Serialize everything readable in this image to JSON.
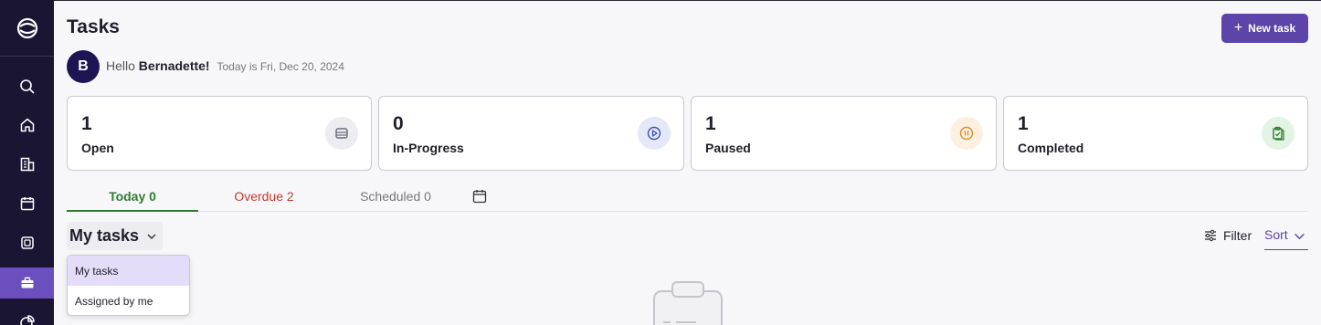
{
  "sidebar": {
    "logo": "app-logo",
    "items": [
      {
        "icon": "search-icon"
      },
      {
        "icon": "home-icon"
      },
      {
        "icon": "building-icon"
      },
      {
        "icon": "calendar-icon"
      },
      {
        "icon": "chip-icon"
      },
      {
        "icon": "briefcase-icon",
        "active": true
      },
      {
        "icon": "chart-icon"
      }
    ]
  },
  "header": {
    "title": "Tasks",
    "new_task_label": "New task",
    "new_task_icon": "+"
  },
  "user": {
    "avatar_initial": "B",
    "hello": "Hello",
    "name": "Bernadette!",
    "date_text": "Today is Fri, Dec 20, 2024"
  },
  "stats": [
    {
      "count": "1",
      "label": "Open",
      "icon": "inbox-icon",
      "color": "#6b6b78",
      "bg": "#ececf1"
    },
    {
      "count": "0",
      "label": "In-Progress",
      "icon": "play-icon",
      "color": "#3f51b5",
      "bg": "#e4e8f8"
    },
    {
      "count": "1",
      "label": "Paused",
      "icon": "pause-icon",
      "color": "#e08a2b",
      "bg": "#fdf0e1"
    },
    {
      "count": "1",
      "label": "Completed",
      "icon": "clipboard-check-icon",
      "color": "#2e7d32",
      "bg": "#e3f3e4"
    }
  ],
  "tabs": {
    "today": "Today 0",
    "overdue": "Overdue 2",
    "scheduled": "Scheduled 0"
  },
  "scope": {
    "selected": "My tasks",
    "options": [
      "My tasks",
      "Assigned by me"
    ]
  },
  "toolbar": {
    "filter_label": "Filter",
    "sort_label": "Sort"
  },
  "colors": {
    "accent": "#5c44a8",
    "sidebar_bg": "#1a1533",
    "today_green": "#2e7d32",
    "overdue_red": "#c0392b"
  }
}
